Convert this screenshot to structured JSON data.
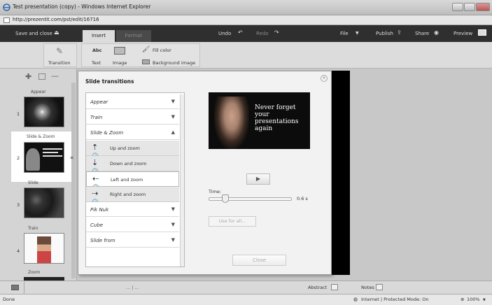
{
  "browser": {
    "title": "Test presentation (copy) - Windows Internet Explorer",
    "url": "http://prezentit.com/pst/edit/16716"
  },
  "toolbar": {
    "save_close": "Save and close",
    "undo": "Undo",
    "redo": "Redo",
    "file": "File",
    "publish": "Publish",
    "share": "Share",
    "preview": "Preview"
  },
  "tabs": {
    "insert": "Insert",
    "format": "Format"
  },
  "ribbon": {
    "transition": "Transition",
    "text_icon": "Abc",
    "text": "Text",
    "image": "Image",
    "fill_color": "Fill color",
    "background_image": "Background image"
  },
  "slides": [
    {
      "num": "1",
      "label": "Appear"
    },
    {
      "num": "2",
      "label": "Slide & Zoom"
    },
    {
      "num": "3",
      "label": "Slide"
    },
    {
      "num": "4",
      "label": "Train"
    },
    {
      "num": "",
      "label": "Zoom"
    }
  ],
  "dialog": {
    "title": "Slide transitions",
    "close_x": "×",
    "items": {
      "appear": "Appear",
      "train": "Train",
      "slide_zoom": "Slide & Zoom",
      "piknuk": "Pik Nuk",
      "cube": "Cube",
      "slide_from": "Slide from"
    },
    "sub_items": {
      "up": "Up and zoom",
      "down": "Down and zoom",
      "left": "Left and zoom",
      "right": "Right and zoom"
    },
    "preview_text": "Never forget your presentations again",
    "time_label": "Time:",
    "time_value": "0.6 s",
    "time_fraction": 0.2,
    "use_for_all": "Use for all...",
    "close": "Close"
  },
  "bottom": {
    "pager": "... | ...",
    "abstract": "Abstract",
    "notes": "Notes"
  },
  "status": {
    "left": "Done",
    "zone": "Internet | Protected Mode: On",
    "zoom": "100%"
  },
  "colors": {
    "app_toolbar": "#2f2f2f",
    "ribbon": "#dcdcdc",
    "dialog": "#f2f2f2"
  }
}
